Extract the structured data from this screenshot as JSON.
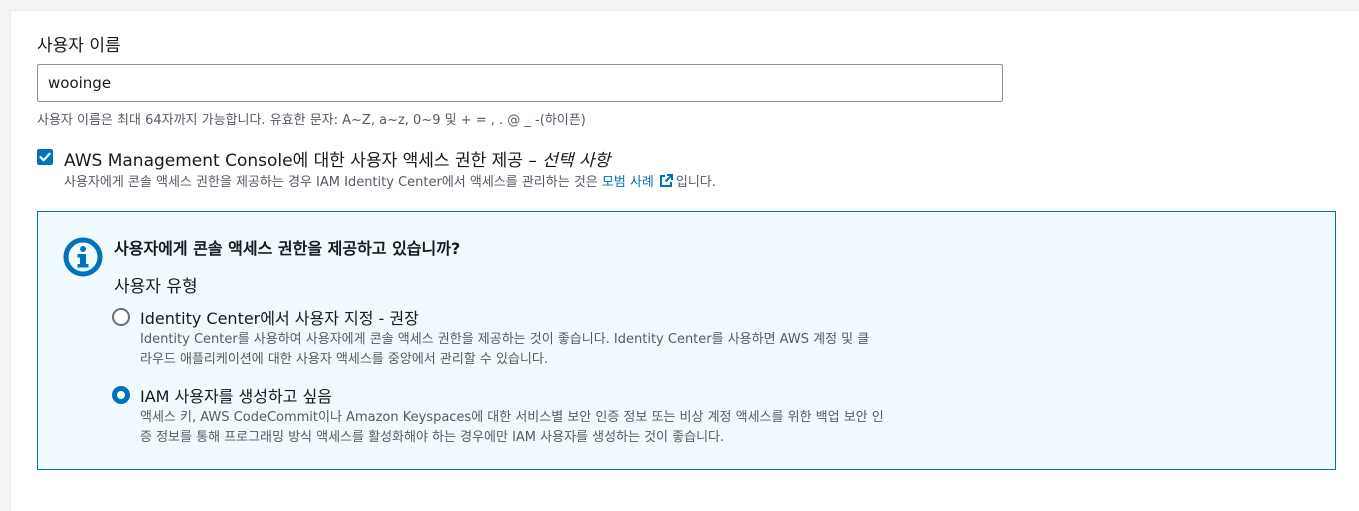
{
  "username": {
    "label": "사용자 이름",
    "value": "wooinge",
    "hint": "사용자 이름은 최대 64자까지 가능합니다. 유효한 문자: A~Z, a~z, 0~9 및 + = , . @ _ -(하이픈)"
  },
  "console_access": {
    "checked": true,
    "label": "AWS Management Console에 대한 사용자 액세스 권한 제공 –",
    "optional": "선택 사항",
    "desc_before": "사용자에게 콘솔 액세스 권한을 제공하는 경우 IAM Identity Center에서 액세스를 관리하는 것은",
    "desc_link": "모범 사례",
    "desc_after": "입니다."
  },
  "info": {
    "icon": "info-icon",
    "title": "사용자에게 콘솔 액세스 권한을 제공하고 있습니까?",
    "user_type_label": "사용자 유형",
    "options": [
      {
        "title": "Identity Center에서 사용자 지정 - 권장",
        "desc_line1": "Identity Center를 사용하여 사용자에게 콘솔 액세스 권한을 제공하는 것이 좋습니다. Identity Center를 사용하면 AWS 계정 및 클",
        "desc_line2": "라우드 애플리케이션에 대한 사용자 액세스를 중앙에서 관리할 수 있습니다.",
        "selected": false
      },
      {
        "title": "IAM 사용자를 생성하고 싶음",
        "desc_line1": "액세스 키, AWS CodeCommit이나 Amazon Keyspaces에 대한 서비스별 보안 인증 정보 또는 비상 계정 액세스를 위한 백업 보안 인",
        "desc_line2": "증 정보를 통해 프로그래밍 방식 액세스를 활성화해야 하는 경우에만 IAM 사용자를 생성하는 것이 좋습니다.",
        "selected": true
      }
    ]
  },
  "colors": {
    "accent": "#0073bb",
    "info_bg": "#f1faff",
    "text": "#16191f",
    "muted": "#545b64"
  }
}
